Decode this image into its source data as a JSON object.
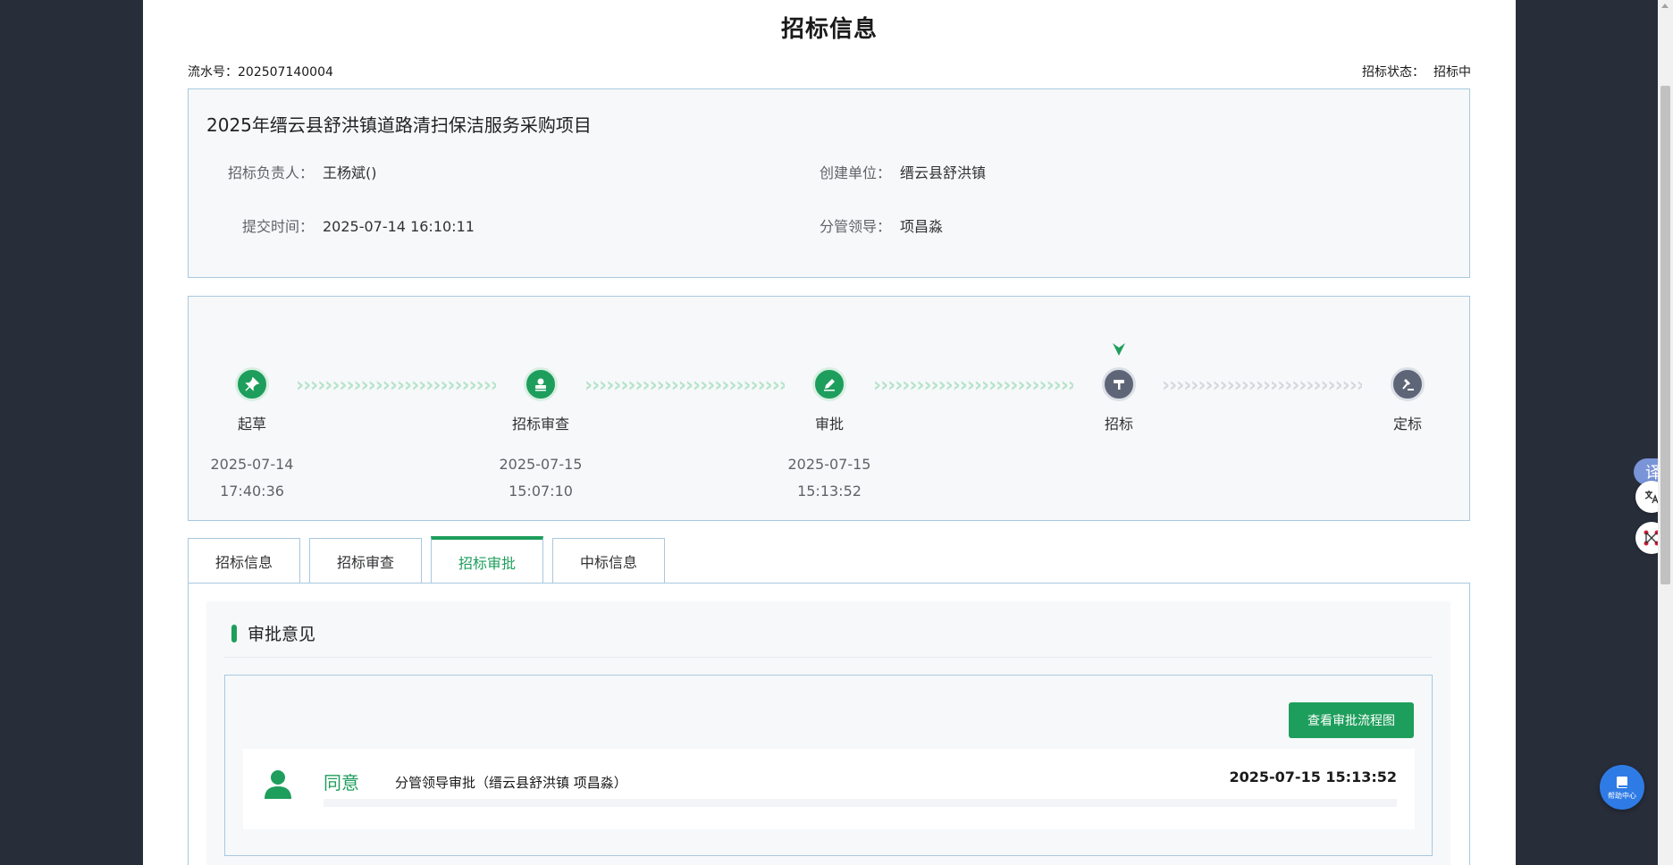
{
  "page": {
    "title": "招标信息",
    "serial_label": "流水号：",
    "serial_value": "202507140004",
    "status_label": "招标状态：",
    "status_value": "招标中"
  },
  "info": {
    "project_name": "2025年缙云县舒洪镇道路清扫保洁服务采购项目",
    "owner_label": "招标负责人：",
    "owner_value": "王杨斌()",
    "unit_label": "创建单位：",
    "unit_value": "缙云县舒洪镇",
    "submit_label": "提交时间：",
    "submit_value": "2025-07-14 16:10:11",
    "leader_label": "分管领导：",
    "leader_value": "项昌淼"
  },
  "steps": [
    {
      "name": "起草",
      "date": "2025-07-14",
      "time": "17:40:36",
      "icon": "pin-icon",
      "state": "done"
    },
    {
      "name": "招标审查",
      "date": "2025-07-15",
      "time": "15:07:10",
      "icon": "stamp-icon",
      "state": "done"
    },
    {
      "name": "审批",
      "date": "2025-07-15",
      "time": "15:13:52",
      "icon": "pen-icon",
      "state": "done"
    },
    {
      "name": "招标",
      "date": "",
      "time": "",
      "icon": "hammer-icon",
      "state": "current"
    },
    {
      "name": "定标",
      "date": "",
      "time": "",
      "icon": "gavel-icon",
      "state": "todo"
    }
  ],
  "tabs": [
    {
      "label": "招标信息",
      "active": false
    },
    {
      "label": "招标审查",
      "active": false
    },
    {
      "label": "招标审批",
      "active": true
    },
    {
      "label": "中标信息",
      "active": false
    }
  ],
  "approval": {
    "section_title": "审批意见",
    "flow_button": "查看审批流程图",
    "records": [
      {
        "result": "同意",
        "description": "分管领导审批（缙云县舒洪镇  项昌淼）",
        "time": "2025-07-15 15:13:52"
      }
    ]
  },
  "floating": {
    "translate_glyph": "译",
    "help_label": "帮助中心"
  },
  "colors": {
    "accent": "#1e9e5c",
    "todo": "#5d6577",
    "border": "#a8c8e0",
    "sidebar": "#282d3a"
  }
}
